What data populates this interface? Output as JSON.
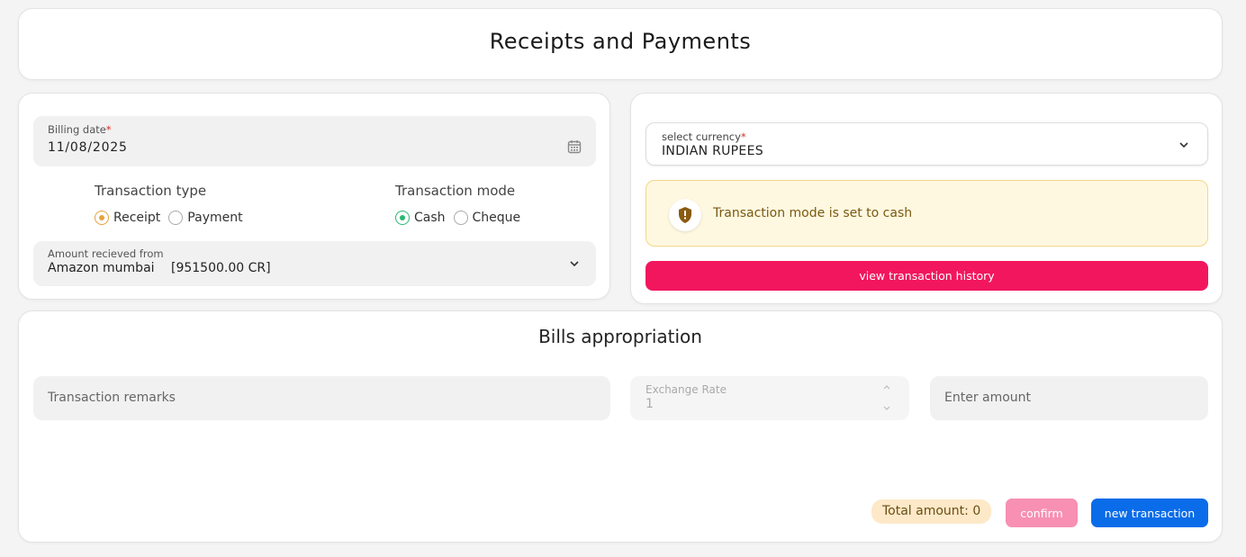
{
  "header": {
    "title": "Receipts and Payments"
  },
  "billing": {
    "date_label": "Billing date",
    "required_mark": "*",
    "date_value": "11/08/2025",
    "calendar_icon": "calendar-icon"
  },
  "transaction_type": {
    "title": "Transaction type",
    "options": [
      {
        "label": "Receipt",
        "selected": true
      },
      {
        "label": "Payment",
        "selected": false
      }
    ]
  },
  "transaction_mode": {
    "title": "Transaction mode",
    "options": [
      {
        "label": "Cash",
        "selected": true
      },
      {
        "label": "Cheque",
        "selected": false
      }
    ]
  },
  "amount_from": {
    "label": "Amount recieved from",
    "party": "Amazon mumbai",
    "balance": "[951500.00 CR]"
  },
  "currency": {
    "label": "select currency",
    "required_mark": "*",
    "value": "INDIAN RUPEES"
  },
  "alert": {
    "icon": "shield-warning-icon",
    "text": "Transaction mode is set to cash"
  },
  "history_button": {
    "label": "view transaction history"
  },
  "bills": {
    "title": "Bills appropriation",
    "remarks_placeholder": "Transaction remarks",
    "exchange_label": "Exchange Rate",
    "exchange_value": "1",
    "amount_placeholder": "Enter amount",
    "total": "Total amount: 0",
    "confirm_label": "confirm",
    "new_label": "new transaction"
  },
  "colors": {
    "primary_pink": "#f2165e",
    "primary_blue": "#0a6ce8",
    "confirm_disabled": "#f790b2",
    "radio_receipt": "#e6a23c",
    "radio_cash": "#2bb673"
  }
}
